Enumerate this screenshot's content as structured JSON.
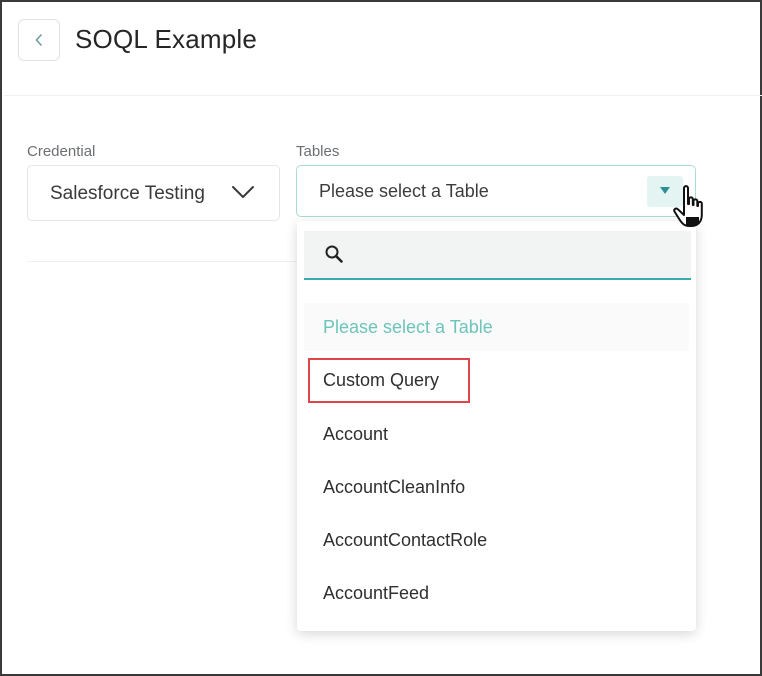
{
  "header": {
    "back_icon": "chevron-left-icon",
    "title": "SOQL Example"
  },
  "credential": {
    "label": "Credential",
    "value": "Salesforce Testing",
    "icon": "chevron-down-icon"
  },
  "tables": {
    "label": "Tables",
    "value": "Please select a Table",
    "icon": "caret-down-icon"
  },
  "dropdown": {
    "search": {
      "icon": "search-icon",
      "value": "",
      "placeholder": ""
    },
    "placeholder_option": "Please select a Table",
    "options": [
      "Custom Query",
      "Account",
      "AccountCleanInfo",
      "AccountContactRole",
      "AccountFeed"
    ],
    "highlighted_option": "Custom Query"
  },
  "colors": {
    "accent": "#38aab2",
    "placeholder_text": "#6cc4ba",
    "highlight_border": "#e0454a"
  }
}
